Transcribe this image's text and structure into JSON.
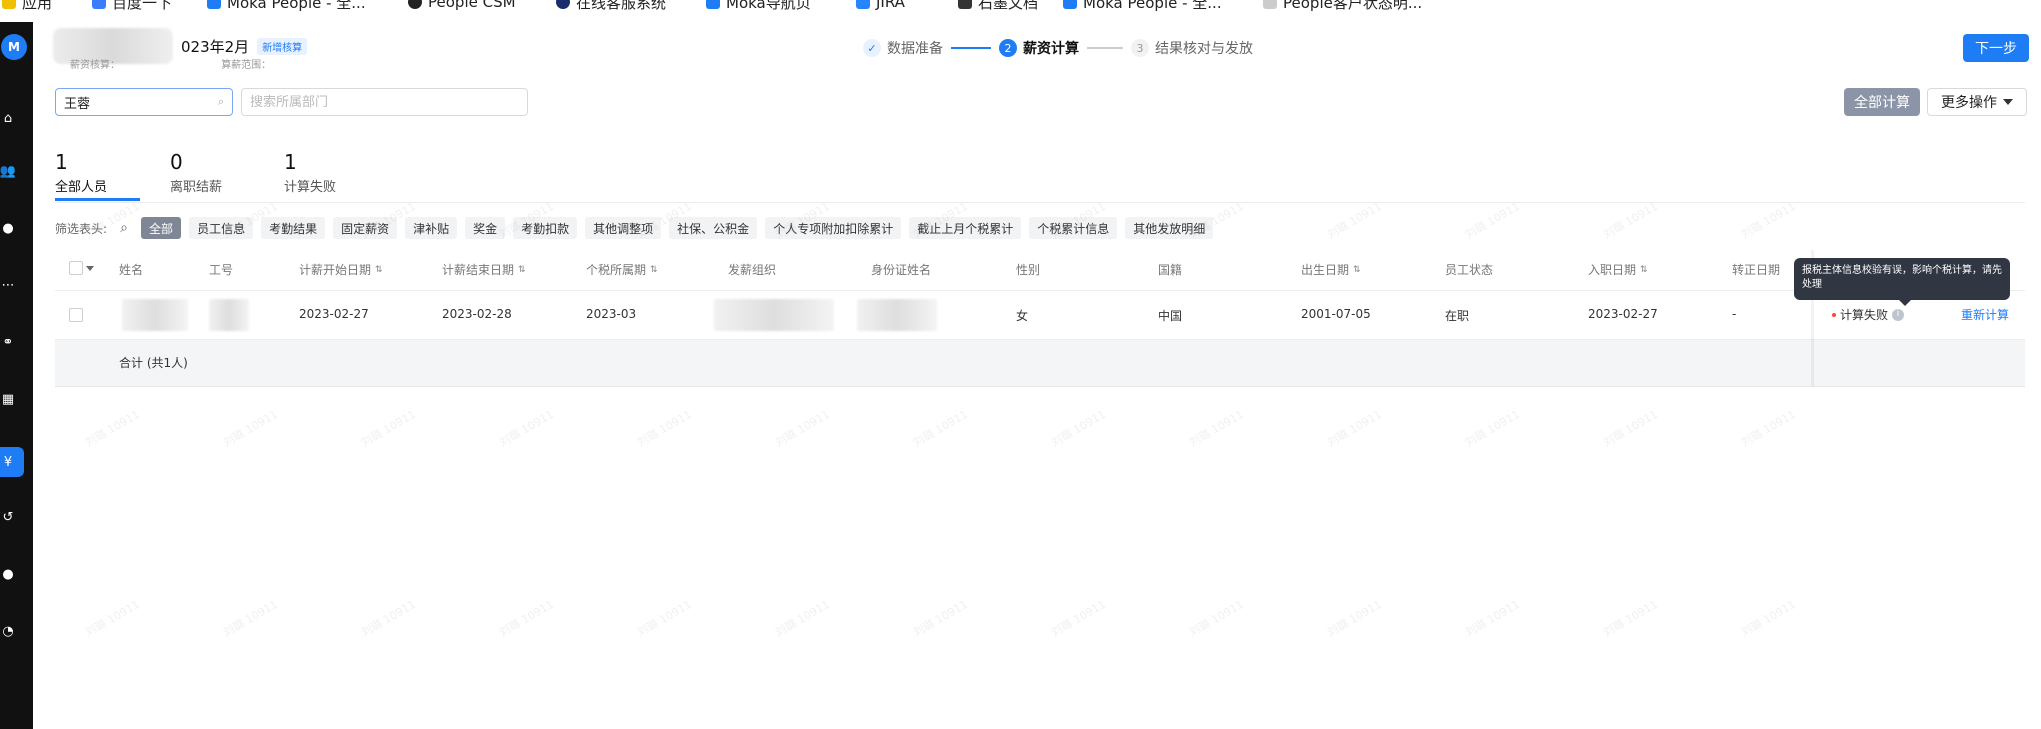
{
  "bookmarks": [
    "应用",
    "百度一下",
    "Moka People - 全...",
    "People CSM",
    "在线客服系统",
    "Moka导航页",
    "JIRA",
    "石墨文档",
    "Moka People - 全...",
    "People客户状态明..."
  ],
  "app": {
    "title_visible": "023年2月",
    "title_badge": "新增核算",
    "subline_left": "薪资核算：",
    "subline_right": "算薪范围："
  },
  "steps": [
    {
      "number": "✓",
      "label": "数据准备",
      "state": "done"
    },
    {
      "number": "2",
      "label": "薪资计算",
      "state": "active"
    },
    {
      "number": "3",
      "label": "结果核对与发放",
      "state": "todo"
    }
  ],
  "actions": {
    "next_label": "下一步",
    "calc_all_label": "全部计算",
    "more_ops_label": "更多操作"
  },
  "search": {
    "name_value": "王蓉",
    "dept_placeholder": "搜索所属部门"
  },
  "summary": [
    {
      "value": "1",
      "label": "全部人员",
      "active": true
    },
    {
      "value": "0",
      "label": "离职结薪",
      "active": false
    },
    {
      "value": "1",
      "label": "计算失败",
      "active": false
    }
  ],
  "filter": {
    "label": "筛选表头:",
    "chips": [
      {
        "label": "全部",
        "active": true
      },
      {
        "label": "员工信息"
      },
      {
        "label": "考勤结果"
      },
      {
        "label": "固定薪资"
      },
      {
        "label": "津补贴"
      },
      {
        "label": "奖金"
      },
      {
        "label": "考勤扣款"
      },
      {
        "label": "其他调整项"
      },
      {
        "label": "社保、公积金"
      },
      {
        "label": "个人专项附加扣除累计"
      },
      {
        "label": "截止上月个税累计"
      },
      {
        "label": "个税累计信息"
      },
      {
        "label": "其他发放明细"
      }
    ]
  },
  "table": {
    "columns": [
      {
        "label": "姓名",
        "sortable": false
      },
      {
        "label": "工号",
        "sortable": false
      },
      {
        "label": "计薪开始日期",
        "sortable": true
      },
      {
        "label": "计薪结束日期",
        "sortable": true
      },
      {
        "label": "个税所属期",
        "sortable": true
      },
      {
        "label": "发薪组织",
        "sortable": false
      },
      {
        "label": "身份证姓名",
        "sortable": false
      },
      {
        "label": "性别",
        "sortable": false
      },
      {
        "label": "国籍",
        "sortable": false
      },
      {
        "label": "出生日期",
        "sortable": true
      },
      {
        "label": "员工状态",
        "sortable": false
      },
      {
        "label": "入职日期",
        "sortable": true
      },
      {
        "label": "转正日期",
        "sortable": false
      }
    ],
    "row": {
      "start_date": "2023-02-27",
      "end_date": "2023-02-28",
      "tax_period": "2023-03",
      "gender": "女",
      "nationality": "中国",
      "birth_date": "2001-07-05",
      "status": "在职",
      "hire_date": "2023-02-27",
      "regularization_date": "-",
      "calc_status": "计算失败",
      "action": "重新计算"
    },
    "total": "合计 (共1人)"
  },
  "tooltip": {
    "text": "报税主体信息校验有误，影响个税计算，请先处理"
  },
  "watermark": "刘璐 10911",
  "colors": {
    "accent": "#1e7cf5",
    "rail": "#111111",
    "fail_dot": "#ff4444",
    "tooltip": "#313643"
  }
}
